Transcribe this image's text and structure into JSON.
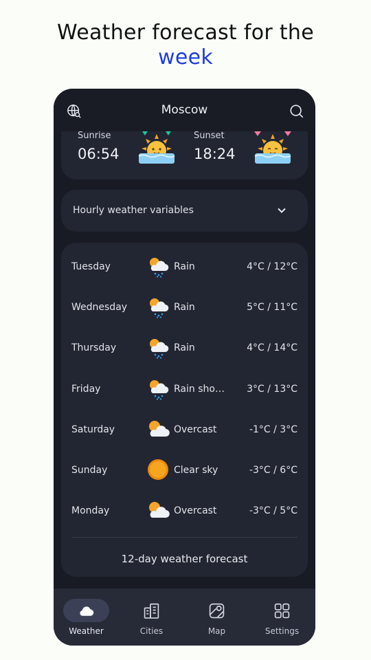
{
  "headline": {
    "line1": "Weather forecast for the",
    "line2": "week"
  },
  "header": {
    "city": "Moscow"
  },
  "sun": {
    "sunrise_label": "Sunrise",
    "sunrise_time": "06:54",
    "sunset_label": "Sunset",
    "sunset_time": "18:24"
  },
  "hourly": {
    "label": "Hourly weather variables"
  },
  "forecast": [
    {
      "day": "Tuesday",
      "icon": "rain-cloud-icon",
      "condition": "Rain",
      "temp": "4°C / 12°C"
    },
    {
      "day": "Wednesday",
      "icon": "rain-cloud-icon",
      "condition": "Rain",
      "temp": "5°C / 11°C"
    },
    {
      "day": "Thursday",
      "icon": "rain-cloud-icon",
      "condition": "Rain",
      "temp": "4°C / 14°C"
    },
    {
      "day": "Friday",
      "icon": "rain-cloud-icon",
      "condition": "Rain sho…",
      "temp": "3°C / 13°C"
    },
    {
      "day": "Saturday",
      "icon": "overcast-icon",
      "condition": "Overcast",
      "temp": "-1°C / 3°C"
    },
    {
      "day": "Sunday",
      "icon": "sun-icon",
      "condition": "Clear sky",
      "temp": "-3°C / 6°C"
    },
    {
      "day": "Monday",
      "icon": "overcast-icon",
      "condition": "Overcast",
      "temp": "-3°C / 5°C"
    }
  ],
  "more_button": "12-day weather forecast",
  "nav": [
    {
      "label": "Weather",
      "icon": "cloud-icon"
    },
    {
      "label": "Cities",
      "icon": "buildings-icon"
    },
    {
      "label": "Map",
      "icon": "map-icon"
    },
    {
      "label": "Settings",
      "icon": "grid-icon"
    }
  ],
  "colors": {
    "accent": "#1f3ce0",
    "background": "#181b24",
    "card": "#222632",
    "navbar": "#272a37"
  }
}
